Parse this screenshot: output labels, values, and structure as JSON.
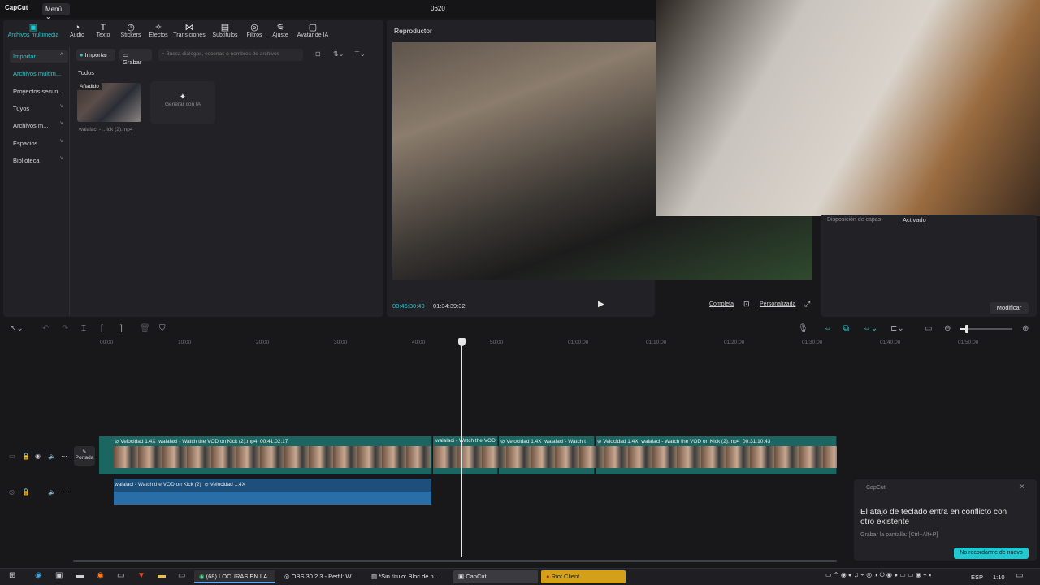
{
  "app": {
    "logo": "CapCut",
    "menu": "Menú ⌄",
    "project_title": "0620"
  },
  "toolbar": [
    {
      "label": "Archivos multimedia",
      "icon": "media-icon",
      "active": true
    },
    {
      "label": "Audio",
      "icon": "audio-icon"
    },
    {
      "label": "Texto",
      "icon": "text-icon"
    },
    {
      "label": "Stickers",
      "icon": "sticker-icon"
    },
    {
      "label": "Efectos",
      "icon": "effects-icon"
    },
    {
      "label": "Transiciones",
      "icon": "transitions-icon"
    },
    {
      "label": "Subtítulos",
      "icon": "subtitles-icon"
    },
    {
      "label": "Filtros",
      "icon": "filters-icon"
    },
    {
      "label": "Ajuste",
      "icon": "adjust-icon"
    },
    {
      "label": "Avatar de IA",
      "icon": "avatar-icon"
    }
  ],
  "sidebar": [
    {
      "label": "Importar",
      "selected": true
    },
    {
      "label": "Archivos multim..."
    },
    {
      "label": "Proyectos secun..."
    },
    {
      "label": "Tuyos"
    },
    {
      "label": "Archivos m..."
    },
    {
      "label": "Espacios"
    },
    {
      "label": "Biblioteca"
    }
  ],
  "media": {
    "import_btn": "Importar",
    "record_btn": "Grabar",
    "search_placeholder": "Busca diálogos, escenas o nombres de archivos",
    "all_label": "Todos",
    "thumb_badge": "Añadido",
    "thumb_name": "walalaci - ...ick (2).mp4",
    "generate_label": "Generar con IA"
  },
  "player": {
    "title": "Reproductor",
    "current_time": "00:46:30:49",
    "total_time": "01:34:39:32",
    "complete_btn": "Completa",
    "custom_btn": "Personalizada"
  },
  "properties": {
    "layer_label": "Disposición de capas",
    "layer_value": "Activado",
    "modify_btn": "Modificar"
  },
  "ruler": [
    "00:00",
    "10:00",
    "20:00",
    "30:00",
    "40:00",
    "50:00",
    "01:00:00",
    "01:10:00",
    "01:20:00",
    "01:30:00",
    "01:40:00",
    "01:50:00"
  ],
  "track": {
    "cover_label": "Portada",
    "clip1_speed": "Velocidad 1.4X",
    "clip1_name": "walalaci - Watch the VOD on Kick (2).mp4",
    "clip1_dur": "00:41:02:17",
    "clip2_name": "walalaci - Watch the VOD",
    "clip3_speed": "Velocidad 1.4X",
    "clip3_name": "walalaci - Watch t",
    "clip4_speed": "Velocidad 1.4X",
    "clip4_name": "walalaci - Watch the VOD on Kick (2).mp4",
    "clip4_dur": "00:31:10:43",
    "audio_name": "walalaci - Watch the VOD on Kick (2)",
    "audio_speed": "Velocidad 1.4X"
  },
  "toast": {
    "app": "CapCut",
    "title": "El atajo de teclado entra en conflicto con otro existente",
    "subtitle": "Grabar la pantalla: [Ctrl+Alt+P]",
    "button": "No recordarme de nuevo"
  },
  "taskbar": {
    "tasks": [
      "(68) LOCURAS EN LA...",
      "OBS 30.2.3 - Perfil: W...",
      "*Sin título: Bloc de n...",
      "CapCut",
      "Riot Client"
    ],
    "lang": "ESP",
    "time": "1:10"
  },
  "colors": {
    "accent": "#22c7cf",
    "clip": "#1c6661",
    "audio": "#1e4f7a",
    "riot": "#d4a017"
  }
}
